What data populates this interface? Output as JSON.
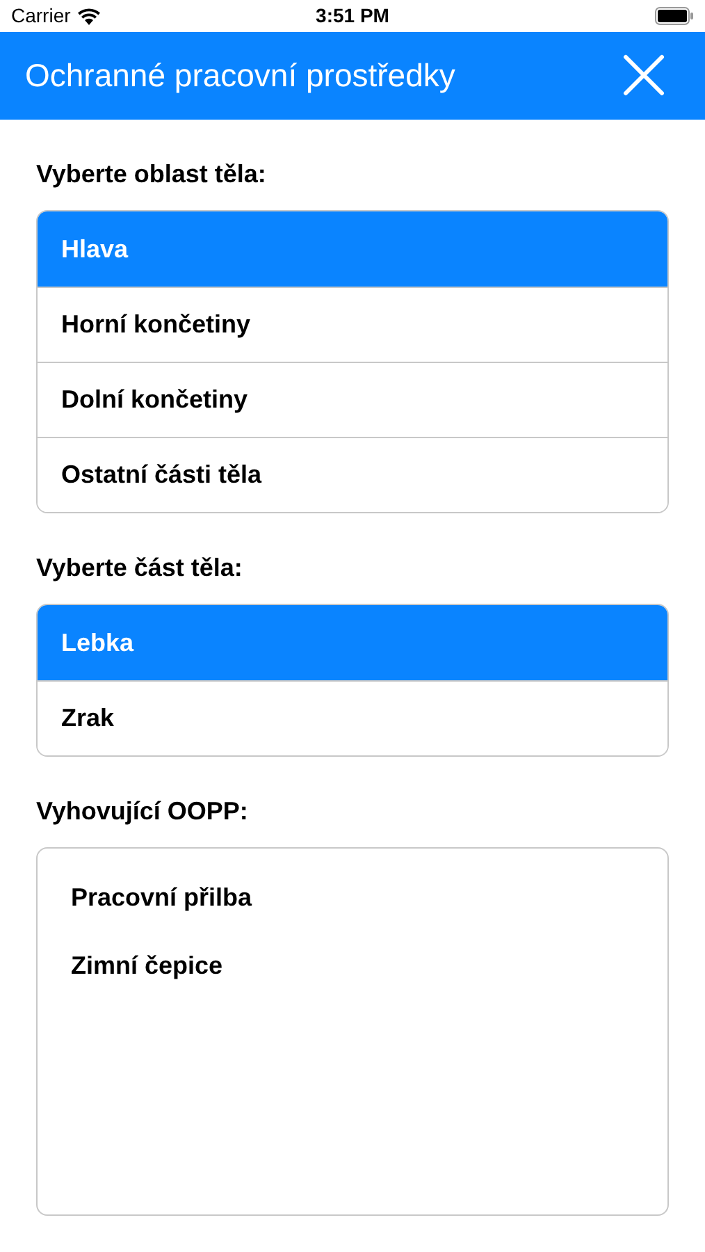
{
  "status_bar": {
    "carrier": "Carrier",
    "time": "3:51 PM"
  },
  "header": {
    "title": "Ochranné pracovní prostředky"
  },
  "sections": [
    {
      "label": "Vyberte oblast těla:",
      "kind": "picker",
      "items": [
        {
          "label": "Hlava",
          "selected": true
        },
        {
          "label": "Horní končetiny",
          "selected": false
        },
        {
          "label": "Dolní končetiny",
          "selected": false
        },
        {
          "label": "Ostatní části těla",
          "selected": false
        }
      ]
    },
    {
      "label": "Vyberte část těla:",
      "kind": "picker",
      "items": [
        {
          "label": "Lebka",
          "selected": true
        },
        {
          "label": "Zrak",
          "selected": false
        }
      ]
    },
    {
      "label": "Vyhovující OOPP:",
      "kind": "results",
      "items": [
        {
          "label": "Pracovní přilba"
        },
        {
          "label": "Zimní čepice"
        }
      ]
    }
  ]
}
